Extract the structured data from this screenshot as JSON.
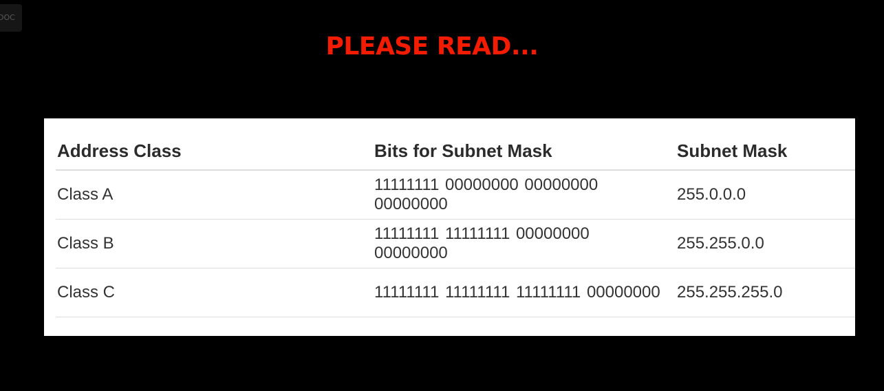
{
  "badge": {
    "label": "DOC"
  },
  "headline": {
    "text": "PLEASE READ..."
  },
  "table": {
    "headers": [
      "Address Class",
      "Bits for Subnet Mask",
      "Subnet Mask"
    ],
    "rows": [
      [
        "Class A",
        "11111111 00000000 00000000 00000000",
        "255.0.0.0"
      ],
      [
        "Class B",
        "11111111 11111111 00000000 00000000",
        "255.255.0.0"
      ],
      [
        "Class C",
        "11111111 11111111 11111111 00000000",
        "255.255.255.0"
      ]
    ]
  },
  "colors": {
    "background": "#000000",
    "headline": "#f41c00",
    "panel": "#ffffff",
    "text": "#333333",
    "rule": "#dddddd"
  }
}
